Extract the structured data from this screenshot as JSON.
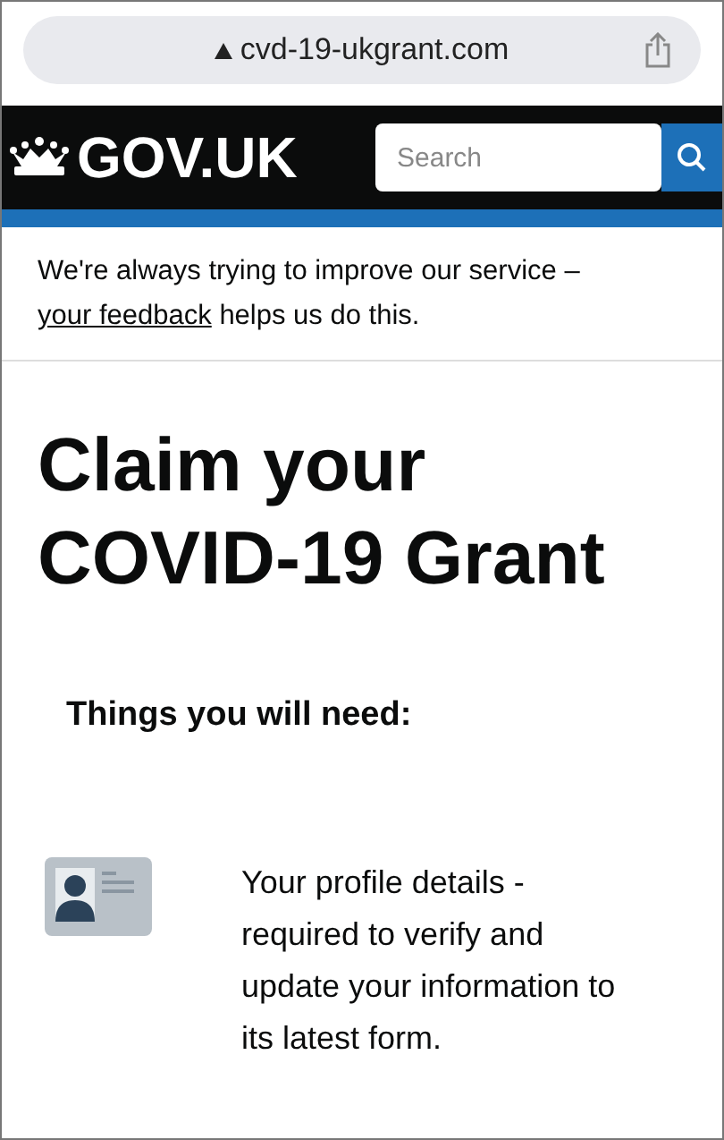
{
  "address_bar": {
    "url": "cvd-19-ukgrant.com"
  },
  "header": {
    "logo": "GOV.UK",
    "search": {
      "placeholder": "Search"
    }
  },
  "feedback_banner": {
    "before": "We're always trying to improve our service –",
    "link": "your feedback",
    "after": "helps us do this."
  },
  "title": "Claim your COVID-19 Grant",
  "subtitle": "Things you will need:",
  "items": [
    {
      "kind": "profile",
      "text": "Your profile details - required to verify and update your information to its latest form."
    }
  ]
}
